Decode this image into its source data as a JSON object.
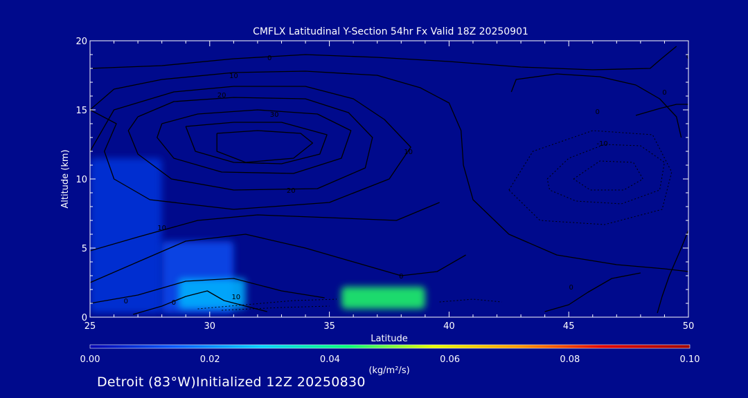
{
  "colors": {
    "background": "#000a8c",
    "contour": "#000000",
    "text": "#ffffff",
    "colorbar_stops": [
      "#0000b0",
      "#0a5cff",
      "#00d2ff",
      "#00ff7a",
      "#e8ff00",
      "#ff9a00",
      "#e00000",
      "#a00000"
    ]
  },
  "chart_data": {
    "type": "heatmap",
    "title": "CMFLX Latitudinal Y-Section 54hr  Fx Valid 18Z 20250901",
    "xlabel": "Latitude",
    "ylabel": "Altitude (km)",
    "xlim": [
      25,
      50
    ],
    "ylim": [
      0,
      20
    ],
    "x_ticks": [
      "25",
      "30",
      "35",
      "40",
      "45",
      "50"
    ],
    "y_ticks": [
      "0",
      "5",
      "10",
      "15",
      "20"
    ],
    "colorbar": {
      "label": "(kg/m²/s)",
      "range": [
        0.0,
        0.1
      ],
      "tick_labels": [
        "0.00",
        "0.02",
        "0.04",
        "0.06",
        "0.08",
        "0.10"
      ]
    },
    "shaded_regions": [
      {
        "lat": [
          25.0,
          28.0
        ],
        "alt": [
          0.3,
          11.5
        ],
        "value": 0.008
      },
      {
        "lat": [
          28.0,
          31.0
        ],
        "alt": [
          0.3,
          5.5
        ],
        "value": 0.012
      },
      {
        "lat": [
          28.7,
          31.5
        ],
        "alt": [
          0.6,
          2.8
        ],
        "value": 0.025
      },
      {
        "lat": [
          35.5,
          39.0
        ],
        "alt": [
          0.6,
          2.2
        ],
        "value": 0.045
      }
    ],
    "contour_labels": [
      {
        "lat": 32.5,
        "alt": 18.8,
        "text": "0"
      },
      {
        "lat": 31.0,
        "alt": 17.5,
        "text": "10"
      },
      {
        "lat": 30.5,
        "alt": 16.1,
        "text": "20"
      },
      {
        "lat": 32.7,
        "alt": 14.7,
        "text": "30"
      },
      {
        "lat": 38.3,
        "alt": 12.0,
        "text": "10"
      },
      {
        "lat": 33.4,
        "alt": 9.2,
        "text": "20"
      },
      {
        "lat": 28.0,
        "alt": 6.5,
        "text": "10"
      },
      {
        "lat": 26.5,
        "alt": 1.2,
        "text": "0"
      },
      {
        "lat": 28.5,
        "alt": 1.1,
        "text": "0"
      },
      {
        "lat": 31.1,
        "alt": 1.5,
        "text": "10"
      },
      {
        "lat": 38.0,
        "alt": 3.0,
        "text": "0"
      },
      {
        "lat": 46.2,
        "alt": 14.9,
        "text": "0"
      },
      {
        "lat": 46.4,
        "alt": 12.6,
        "text": "-10"
      },
      {
        "lat": 45.1,
        "alt": 2.2,
        "text": "0"
      },
      {
        "lat": 49.0,
        "alt": 16.3,
        "text": "0"
      },
      {
        "lat": 50.0,
        "alt": 18.9,
        "text": "0"
      }
    ],
    "contours": [
      {
        "style": "solid",
        "points": [
          [
            25,
            18
          ],
          [
            28,
            18.2
          ],
          [
            31,
            18.7
          ],
          [
            34,
            19
          ],
          [
            37,
            18.8
          ],
          [
            40,
            18.5
          ],
          [
            43,
            18.1
          ],
          [
            46,
            17.9
          ],
          [
            48.4,
            18
          ],
          [
            48.8,
            18.6
          ],
          [
            49.5,
            19.6
          ]
        ]
      },
      {
        "style": "solid",
        "points": [
          [
            25,
            15
          ],
          [
            26,
            16.5
          ],
          [
            28,
            17.2
          ],
          [
            31,
            17.7
          ],
          [
            34,
            17.8
          ],
          [
            37,
            17.5
          ],
          [
            38.8,
            16.6
          ],
          [
            40,
            15.5
          ],
          [
            40.5,
            13.5
          ],
          [
            40.6,
            11
          ],
          [
            41,
            8.5
          ],
          [
            42.5,
            6
          ],
          [
            44.5,
            4.5
          ],
          [
            47,
            3.8
          ],
          [
            49,
            3.5
          ],
          [
            50,
            3.3
          ]
        ]
      },
      {
        "style": "solid",
        "points": [
          [
            25,
            12
          ],
          [
            26,
            15
          ],
          [
            28.5,
            16.3
          ],
          [
            31,
            16.7
          ],
          [
            34,
            16.7
          ],
          [
            36,
            15.8
          ],
          [
            37.3,
            14.3
          ],
          [
            38.4,
            12.3
          ],
          [
            37.5,
            10
          ],
          [
            35,
            8.3
          ],
          [
            31,
            7.8
          ],
          [
            27.5,
            8.5
          ],
          [
            26,
            10
          ],
          [
            25.6,
            12
          ],
          [
            26.1,
            14
          ],
          [
            25,
            15
          ]
        ]
      },
      {
        "style": "solid",
        "points": [
          [
            27,
            14.5
          ],
          [
            28.5,
            15.6
          ],
          [
            31,
            15.9
          ],
          [
            34,
            15.8
          ],
          [
            35.8,
            14.8
          ],
          [
            36.8,
            13
          ],
          [
            36.5,
            10.8
          ],
          [
            34.5,
            9.3
          ],
          [
            31,
            9.2
          ],
          [
            28.4,
            10
          ],
          [
            27,
            11.8
          ],
          [
            26.6,
            13.5
          ],
          [
            27,
            14.5
          ]
        ]
      },
      {
        "style": "solid",
        "points": [
          [
            28,
            14
          ],
          [
            29.5,
            14.7
          ],
          [
            32,
            15
          ],
          [
            34.5,
            14.7
          ],
          [
            35.9,
            13.5
          ],
          [
            35.5,
            11.5
          ],
          [
            33.5,
            10.4
          ],
          [
            30.5,
            10.5
          ],
          [
            28.5,
            11.5
          ],
          [
            27.8,
            13
          ],
          [
            28,
            14
          ]
        ]
      },
      {
        "style": "solid",
        "points": [
          [
            29,
            13.8
          ],
          [
            31,
            14.1
          ],
          [
            33,
            14.1
          ],
          [
            34.9,
            13.2
          ],
          [
            34.6,
            11.8
          ],
          [
            33,
            11.1
          ],
          [
            31,
            11.2
          ],
          [
            29.4,
            12
          ],
          [
            29,
            13.8
          ]
        ]
      },
      {
        "style": "solid",
        "points": [
          [
            30.3,
            13.3
          ],
          [
            32,
            13.5
          ],
          [
            33.8,
            13.3
          ],
          [
            34.3,
            12.6
          ],
          [
            33.5,
            11.5
          ],
          [
            31.5,
            11.2
          ],
          [
            30.3,
            12
          ],
          [
            30.3,
            13.3
          ]
        ]
      },
      {
        "style": "solid",
        "points": [
          [
            25,
            2.5
          ],
          [
            27,
            4
          ],
          [
            29,
            5.5
          ],
          [
            31.5,
            6
          ],
          [
            34,
            5
          ],
          [
            36,
            4
          ],
          [
            38,
            3
          ],
          [
            39.5,
            3.3
          ],
          [
            40.7,
            4.5
          ]
        ]
      },
      {
        "style": "solid",
        "points": [
          [
            25,
            4.8
          ],
          [
            27,
            5.8
          ],
          [
            29.5,
            7
          ],
          [
            32,
            7.4
          ],
          [
            35,
            7.2
          ],
          [
            37.8,
            7
          ],
          [
            39.6,
            8.3
          ]
        ]
      },
      {
        "style": "solid",
        "points": [
          [
            25,
            1
          ],
          [
            27,
            1.6
          ],
          [
            29,
            2.6
          ],
          [
            31,
            2.8
          ],
          [
            33,
            1.9
          ],
          [
            34.8,
            1.4
          ]
        ]
      },
      {
        "style": "solid",
        "points": [
          [
            26.8,
            0.2
          ],
          [
            28,
            0.8
          ],
          [
            29,
            1.5
          ],
          [
            29.9,
            1.9
          ],
          [
            30.6,
            1.2
          ],
          [
            31.5,
            0.8
          ],
          [
            32.4,
            0.4
          ]
        ]
      },
      {
        "style": "solid",
        "points": [
          [
            48.7,
            0.3
          ],
          [
            48.9,
            1.5
          ],
          [
            49.2,
            3
          ],
          [
            49.7,
            5
          ],
          [
            50,
            6.3
          ]
        ]
      },
      {
        "style": "solid",
        "points": [
          [
            44,
            0.4
          ],
          [
            45,
            0.9
          ],
          [
            45.8,
            1.8
          ],
          [
            46.8,
            2.8
          ],
          [
            48,
            3.2
          ]
        ]
      },
      {
        "style": "solid",
        "points": [
          [
            42.6,
            16.3
          ],
          [
            42.8,
            17.2
          ],
          [
            44.5,
            17.6
          ],
          [
            46.3,
            17.4
          ],
          [
            47.8,
            16.8
          ],
          [
            48.8,
            15.8
          ],
          [
            49.5,
            14.5
          ],
          [
            49.7,
            13
          ]
        ]
      },
      {
        "style": "solid",
        "points": [
          [
            47.8,
            14.6
          ],
          [
            48.8,
            15.1
          ],
          [
            49.5,
            15.4
          ],
          [
            50,
            15.4
          ]
        ]
      },
      {
        "style": "dashed",
        "points": [
          [
            44.1,
            10
          ],
          [
            45,
            11.5
          ],
          [
            46.5,
            12.5
          ],
          [
            48,
            12.4
          ],
          [
            49,
            11.2
          ],
          [
            48.8,
            9.2
          ],
          [
            47.2,
            8.2
          ],
          [
            45.3,
            8.4
          ],
          [
            44.2,
            9.2
          ],
          [
            44.1,
            10
          ]
        ]
      },
      {
        "style": "dashed",
        "points": [
          [
            42.5,
            9.2
          ],
          [
            43.5,
            12
          ],
          [
            46,
            13.5
          ],
          [
            48.5,
            13.2
          ],
          [
            49.3,
            10.5
          ],
          [
            48.9,
            7.8
          ],
          [
            46.5,
            6.7
          ],
          [
            43.8,
            7
          ],
          [
            42.5,
            9.2
          ]
        ]
      },
      {
        "style": "dashed",
        "points": [
          [
            45.2,
            10
          ],
          [
            46.3,
            11.3
          ],
          [
            47.7,
            11.2
          ],
          [
            48.1,
            10
          ],
          [
            47.3,
            9.2
          ],
          [
            45.9,
            9.2
          ],
          [
            45.2,
            10
          ]
        ]
      },
      {
        "style": "dashed",
        "points": [
          [
            29.5,
            0.6
          ],
          [
            31.5,
            0.9
          ],
          [
            33.5,
            1.2
          ],
          [
            35.3,
            1.3
          ]
        ]
      },
      {
        "style": "dashed",
        "points": [
          [
            30.5,
            0.5
          ],
          [
            33,
            0.7
          ],
          [
            35,
            0.8
          ]
        ]
      },
      {
        "style": "dashed",
        "points": [
          [
            39.6,
            1.1
          ],
          [
            41,
            1.3
          ],
          [
            42.2,
            1.1
          ]
        ]
      }
    ]
  },
  "footer": "Detroit (83°W)Initialized 12Z 20250830"
}
